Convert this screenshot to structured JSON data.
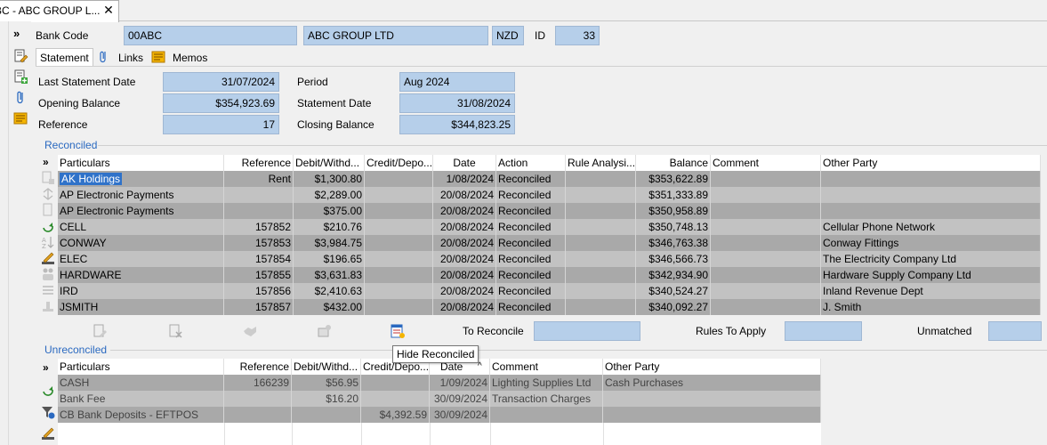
{
  "tab": {
    "title": "BC - ABC GROUP L...",
    "close": "✕"
  },
  "header": {
    "bank_code_label": "Bank Code",
    "bank_code": "00ABC",
    "name": "ABC GROUP LTD",
    "currency": "NZD",
    "id_label": "ID",
    "id": "33"
  },
  "subtabs": {
    "statement": "Statement",
    "links": "Links",
    "memos": "Memos"
  },
  "statement": {
    "last_statement_date_label": "Last Statement Date",
    "last_statement_date": "31/07/2024",
    "opening_balance_label": "Opening Balance",
    "opening_balance": "$354,923.69",
    "reference_label": "Reference",
    "reference": "17",
    "period_label": "Period",
    "period": "Aug 2024",
    "statement_date_label": "Statement Date",
    "statement_date": "31/08/2024",
    "closing_balance_label": "Closing Balance",
    "closing_balance": "$344,823.25"
  },
  "reconciled": {
    "title": "Reconciled",
    "expand": "»",
    "columns": [
      "Particulars",
      "Reference",
      "Debit/Withd...",
      "Credit/Depo...",
      "Date",
      "Action",
      "Rule Analysi...",
      "Balance",
      "Comment",
      "Other Party"
    ],
    "rows": [
      [
        "AK Holdings",
        "Rent",
        "$1,300.80",
        "",
        "1/08/2024",
        "Reconciled",
        "",
        "$353,622.89",
        "",
        ""
      ],
      [
        "AP Electronic Payments",
        "",
        "$2,289.00",
        "",
        "20/08/2024",
        "Reconciled",
        "",
        "$351,333.89",
        "",
        ""
      ],
      [
        "AP Electronic Payments",
        "",
        "$375.00",
        "",
        "20/08/2024",
        "Reconciled",
        "",
        "$350,958.89",
        "",
        ""
      ],
      [
        "CELL",
        "157852",
        "$210.76",
        "",
        "20/08/2024",
        "Reconciled",
        "",
        "$350,748.13",
        "",
        "Cellular Phone Network"
      ],
      [
        "CONWAY",
        "157853",
        "$3,984.75",
        "",
        "20/08/2024",
        "Reconciled",
        "",
        "$346,763.38",
        "",
        "Conway Fittings"
      ],
      [
        "ELEC",
        "157854",
        "$196.65",
        "",
        "20/08/2024",
        "Reconciled",
        "",
        "$346,566.73",
        "",
        "The Electricity Company Ltd"
      ],
      [
        "HARDWARE",
        "157855",
        "$3,631.83",
        "",
        "20/08/2024",
        "Reconciled",
        "",
        "$342,934.90",
        "",
        "Hardware Supply Company Ltd"
      ],
      [
        "IRD",
        "157856",
        "$2,410.63",
        "",
        "20/08/2024",
        "Reconciled",
        "",
        "$340,524.27",
        "",
        "Inland Revenue Dept"
      ],
      [
        "JSMITH",
        "157857",
        "$432.00",
        "",
        "20/08/2024",
        "Reconciled",
        "",
        "$340,092.27",
        "",
        "J. Smith"
      ]
    ]
  },
  "totals": {
    "to_reconcile_label": "To Reconcile",
    "to_reconcile": "",
    "rules_to_apply_label": "Rules To Apply",
    "rules_to_apply": "",
    "unmatched_label": "Unmatched",
    "unmatched": ""
  },
  "tooltip": "Hide Reconciled",
  "unreconciled": {
    "title": "Unreconciled",
    "expand": "»",
    "sort_indicator": "^",
    "columns": [
      "Particulars",
      "Reference",
      "Debit/Withd...",
      "Credit/Depo...",
      "Date",
      "Comment",
      "Other Party"
    ],
    "rows": [
      [
        "CASH",
        "166239",
        "$56.95",
        "",
        "1/09/2024",
        "Lighting Supplies Ltd",
        "Cash Purchases"
      ],
      [
        "Bank Fee",
        "",
        "$16.20",
        "",
        "30/09/2024",
        "Transaction Charges",
        ""
      ],
      [
        "CB Bank Deposits - EFTPOS",
        "",
        "",
        "$4,392.59",
        "30/09/2024",
        "",
        ""
      ]
    ]
  },
  "colors": {
    "field_bg": "#b6cfea",
    "row_odd": "#a9a9a9",
    "row_even": "#c2c2c2",
    "group_title": "#2a69c0"
  },
  "icons": [
    "expand-icon",
    "edit-doc-icon",
    "add-doc-icon",
    "paperclip-icon",
    "memo-icon",
    "refresh-icon",
    "sort-az-icon",
    "edit-pencil-icon",
    "filter-icon"
  ]
}
